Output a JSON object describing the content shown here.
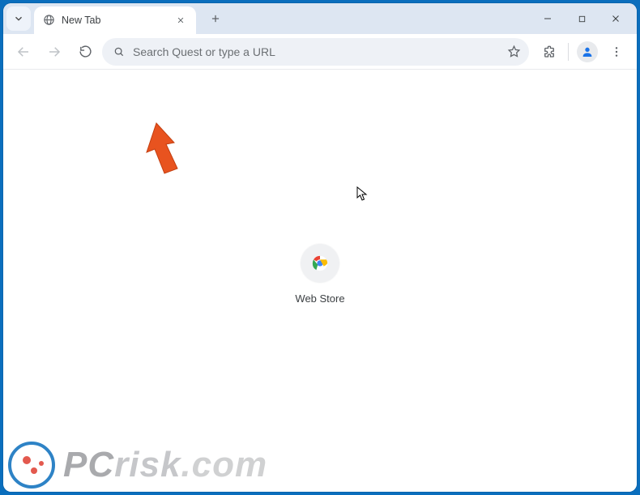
{
  "tab": {
    "title": "New Tab"
  },
  "omnibox": {
    "placeholder": "Search Quest or type a URL",
    "value": ""
  },
  "ntp": {
    "tiles": [
      {
        "label": "Web Store"
      }
    ]
  },
  "watermark": {
    "text_left": "PC",
    "text_right": "risk",
    "text_tld": ".com"
  }
}
